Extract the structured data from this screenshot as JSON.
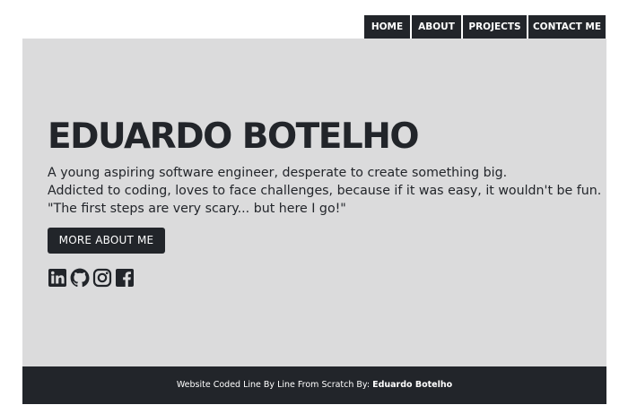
{
  "nav": {
    "items": [
      {
        "label": "HOME"
      },
      {
        "label": "ABOUT"
      },
      {
        "label": "PROJECTS"
      },
      {
        "label": "CONTACT ME"
      }
    ]
  },
  "hero": {
    "title": "EDUARDO BOTELHO",
    "lines": [
      "A young aspiring software engineer, desperate to create something big.",
      "Addicted to coding, loves to face challenges, because if it was easy, it wouldn't be fun.",
      "\"The first steps are very scary... but here I go!\""
    ],
    "button_label": "MORE ABOUT ME",
    "socials": [
      {
        "icon": "linkedin-icon"
      },
      {
        "icon": "github-icon"
      },
      {
        "icon": "instagram-icon"
      },
      {
        "icon": "facebook-icon"
      }
    ]
  },
  "footer": {
    "prefix": "Website Coded Line By Line From Scratch By:",
    "author": "Eduardo Botelho"
  },
  "colors": {
    "dark": "#22252a",
    "hero_bg": "#dbdbdc",
    "page_bg": "#ffffff"
  }
}
